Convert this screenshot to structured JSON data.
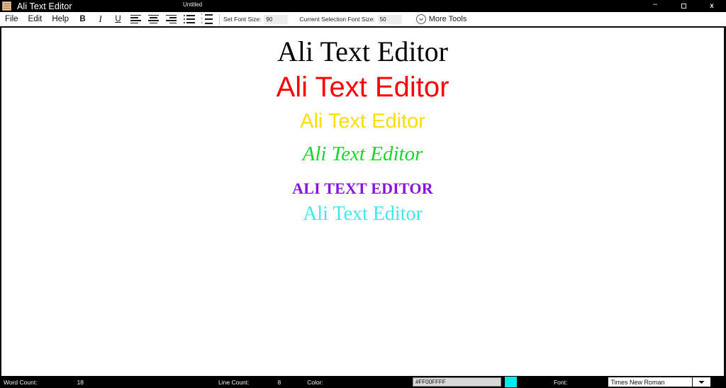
{
  "titlebar": {
    "app_title": "Ali Text Editor",
    "document_name": "Untitled",
    "icon": "app-menu-icon",
    "minimize_label": "–",
    "maximize_label": "maximize",
    "close_label": "x"
  },
  "toolbar": {
    "menus": [
      {
        "label": "File"
      },
      {
        "label": "Edit"
      },
      {
        "label": "Help"
      }
    ],
    "format_buttons": [
      {
        "name": "bold-button",
        "label": "B"
      },
      {
        "name": "italic-button",
        "label": "I"
      },
      {
        "name": "underline-button",
        "label": "U"
      }
    ],
    "align_buttons": [
      {
        "name": "align-left-button",
        "label": "align-left-icon"
      },
      {
        "name": "align-center-button",
        "label": "align-center-icon"
      },
      {
        "name": "align-right-button",
        "label": "align-right-icon"
      }
    ],
    "list_buttons": [
      {
        "name": "bullet-list-button",
        "label": "bullet-list-icon"
      },
      {
        "name": "numbered-list-button",
        "label": "numbered-list-icon"
      }
    ],
    "set_font_size_label": "Set Font Size:",
    "set_font_size_value": "90",
    "current_selection_font_size_label": "Current Selection Font Size:",
    "current_selection_font_size_value": "50",
    "more_tools_label": "More Tools"
  },
  "document": {
    "lines": [
      {
        "text": "Ali Text Editor",
        "color": "#000000",
        "style": "serif-regular"
      },
      {
        "text": "Ali Text Editor",
        "color": "#ff0000",
        "style": "sans-regular"
      },
      {
        "text": "Ali Text Editor",
        "color": "#ffdd00",
        "style": "sans-regular"
      },
      {
        "text": "Ali Text Editor",
        "color": "#18d52a",
        "style": "serif-italic"
      },
      {
        "text": "ALI TEXT EDITOR",
        "color": "#8a12e0",
        "style": "serif-bold"
      },
      {
        "text": "Ali Text Editor",
        "color": "#40e8ee",
        "style": "serif-regular"
      }
    ]
  },
  "statusbar": {
    "word_count_label": "Word Count:",
    "word_count_value": "18",
    "line_count_label": "Line Count:",
    "line_count_value": "8",
    "color_label": "Color:",
    "color_value": "#FF00FFFF",
    "color_swatch": "#00eaf0",
    "font_label": "Font:",
    "font_value": "Times New Roman"
  }
}
